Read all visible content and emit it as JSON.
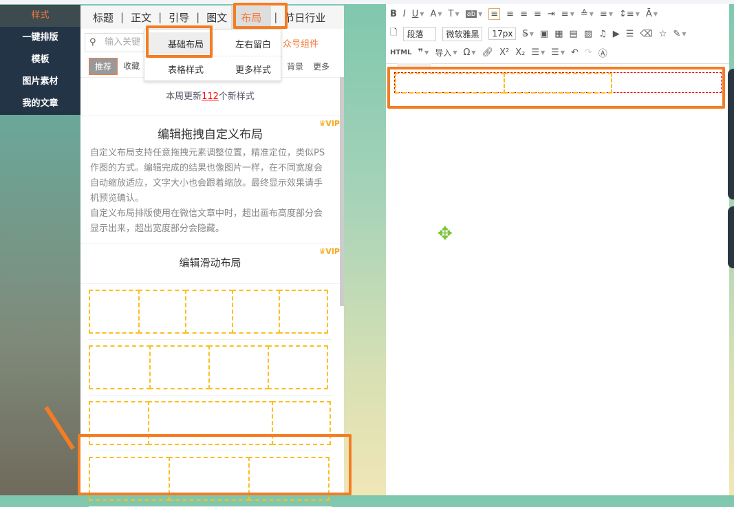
{
  "nav": [
    "样式",
    "一键排版",
    "模板",
    "图片素材",
    "我的文章"
  ],
  "tabs": [
    "标题",
    "正文",
    "引导",
    "图文",
    "布局",
    "节日行业"
  ],
  "search": {
    "placeholder": "输入关键"
  },
  "gzh_link": "众号组件",
  "subtabs": [
    "推荐",
    "收藏"
  ],
  "subtabs_right": [
    "背景",
    "更多"
  ],
  "dropdown": [
    "基础布局",
    "左右留白",
    "表格样式",
    "更多样式"
  ],
  "update": {
    "prefix": "本周更新",
    "count": "112",
    "suffix": "个新样式"
  },
  "cards": [
    {
      "vip": "VIP",
      "title": "编辑拖拽自定义布局",
      "desc": [
        "自定义布局支持任意拖拽元素调整位置，精准定位，类似PS作图的方式。编辑完成的结果也像图片一样，在不同宽度会自动缩放适应，文字大小也会跟着缩放。最终显示效果请手机预览确认。",
        "自定义布局排版使用在微信文章中时，超出画布高度部分会显示出来，超出宽度部分会隐藏。"
      ]
    },
    {
      "vip": "VIP",
      "title": "编辑滑动布局"
    }
  ],
  "editor": {
    "row1": [
      "B",
      "I",
      "U",
      "A",
      "T",
      "ab",
      "≡",
      "≡",
      "≡",
      "≡",
      "≡",
      "≡",
      "≡",
      "≡",
      "≡",
      "A"
    ],
    "paragraph": "段落",
    "font": "微软雅黑",
    "size": "17px",
    "html": "HTML",
    "import": "导入"
  },
  "colors": {
    "accent": "#f47c22",
    "dashed": "#fcbf1f",
    "nav": "#243447"
  }
}
